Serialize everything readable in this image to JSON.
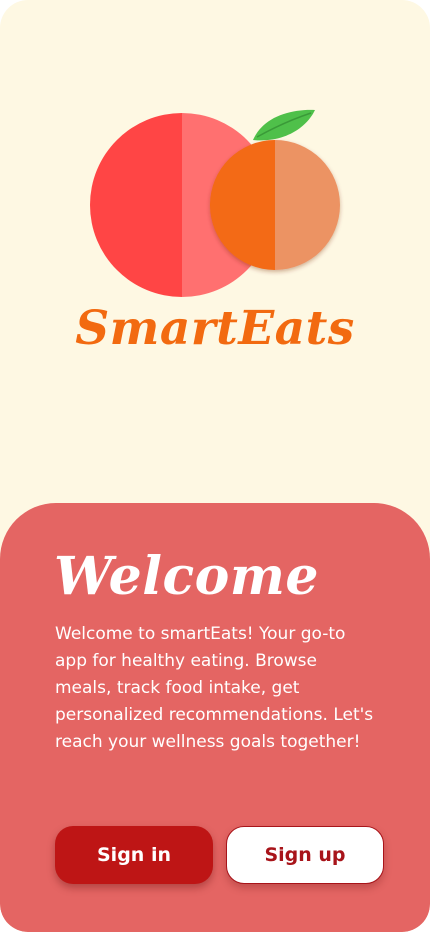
{
  "brand": {
    "name": "SmartEats",
    "logo": "apple-and-orange-logo",
    "colors": {
      "brand_orange": "#F26A10",
      "apple_red": "#FF4848",
      "leaf_green": "#4FC04A",
      "background_cream": "#FEF8E3"
    }
  },
  "welcome": {
    "title": "Welcome",
    "body": "Welcome to smartEats! Your go-to app for healthy eating. Browse meals, track food intake, get personalized recommendations. Let's reach your wellness goals together!",
    "panel_color": "#E46563"
  },
  "actions": {
    "sign_in_label": "Sign in",
    "sign_up_label": "Sign up",
    "sign_in_color": "#BE1515",
    "sign_up_text_color": "#A8141A"
  }
}
